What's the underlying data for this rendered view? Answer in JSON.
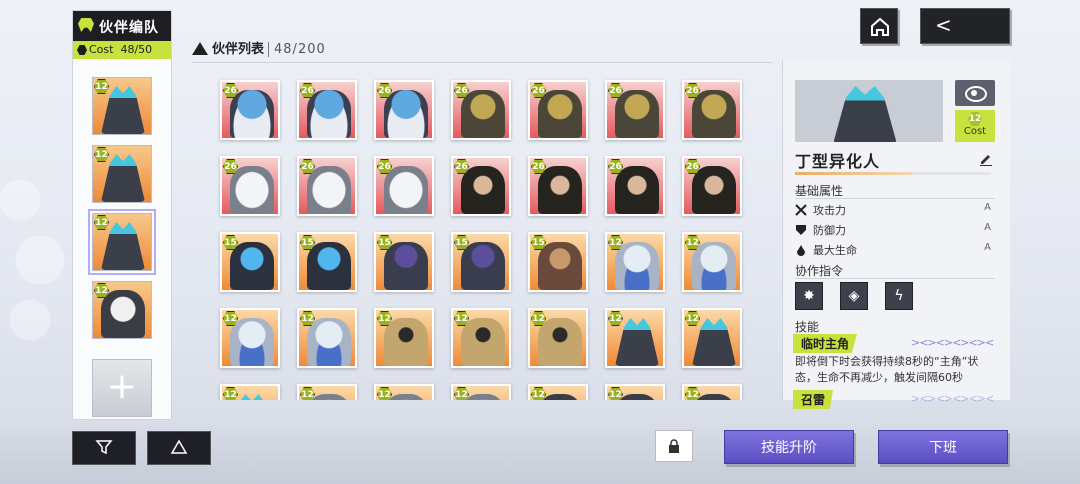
{
  "team": {
    "title": "伙伴编队",
    "cost_label": "Cost",
    "cost_value": "48/50",
    "slots": [
      {
        "level": "12",
        "type": "crys"
      },
      {
        "level": "12",
        "type": "crys"
      },
      {
        "level": "12",
        "type": "crys",
        "selected": true
      },
      {
        "level": "12",
        "type": "robot"
      }
    ],
    "add_symbol": "+"
  },
  "list": {
    "title": "伙伴列表",
    "count": "48/200"
  },
  "grid": [
    {
      "level": "26",
      "bg": "red",
      "type": "blue"
    },
    {
      "level": "26",
      "bg": "red",
      "type": "blue"
    },
    {
      "level": "26",
      "bg": "red",
      "type": "blue"
    },
    {
      "level": "26",
      "bg": "red",
      "type": "gold"
    },
    {
      "level": "26",
      "bg": "red",
      "type": "gold"
    },
    {
      "level": "26",
      "bg": "red",
      "type": "gold"
    },
    {
      "level": "26",
      "bg": "red",
      "type": "gold"
    },
    {
      "level": "26",
      "bg": "red",
      "type": "white"
    },
    {
      "level": "26",
      "bg": "red",
      "type": "white"
    },
    {
      "level": "26",
      "bg": "red",
      "type": "white"
    },
    {
      "level": "26",
      "bg": "red",
      "type": "hair"
    },
    {
      "level": "26",
      "bg": "red",
      "type": "hair"
    },
    {
      "level": "26",
      "bg": "red",
      "type": "hair"
    },
    {
      "level": "26",
      "bg": "red",
      "type": "hair"
    },
    {
      "level": "15",
      "bg": "orange",
      "type": "mech"
    },
    {
      "level": "15",
      "bg": "orange",
      "type": "mech"
    },
    {
      "level": "15",
      "bg": "orange",
      "type": "purple"
    },
    {
      "level": "15",
      "bg": "orange",
      "type": "purple"
    },
    {
      "level": "15",
      "bg": "orange",
      "type": "monk"
    },
    {
      "level": "12",
      "bg": "orange",
      "type": "ghost"
    },
    {
      "level": "12",
      "bg": "orange",
      "type": "ghost"
    },
    {
      "level": "12",
      "bg": "orange",
      "type": "ghost"
    },
    {
      "level": "12",
      "bg": "orange",
      "type": "ghost"
    },
    {
      "level": "12",
      "bg": "orange",
      "type": "tan"
    },
    {
      "level": "12",
      "bg": "orange",
      "type": "tan"
    },
    {
      "level": "12",
      "bg": "orange",
      "type": "tan"
    },
    {
      "level": "12",
      "bg": "orange",
      "type": "crys"
    },
    {
      "level": "12",
      "bg": "orange",
      "type": "crys"
    },
    {
      "level": "12",
      "bg": "orange",
      "type": "crys"
    },
    {
      "level": "12",
      "bg": "orange",
      "type": "white"
    },
    {
      "level": "12",
      "bg": "orange",
      "type": "white"
    },
    {
      "level": "12",
      "bg": "orange",
      "type": "white"
    },
    {
      "level": "12",
      "bg": "orange",
      "type": "robot"
    },
    {
      "level": "12",
      "bg": "orange",
      "type": "robot"
    },
    {
      "level": "12",
      "bg": "orange",
      "type": "robot"
    }
  ],
  "detail": {
    "cost_num": "12",
    "cost_label": "Cost",
    "name": "丁型异化人",
    "base_attr_title": "基础属性",
    "attrs": [
      {
        "label": "攻击力",
        "grade": "A",
        "icon": "sword-icon"
      },
      {
        "label": "防御力",
        "grade": "A",
        "icon": "shield-icon"
      },
      {
        "label": "最大生命",
        "grade": "A",
        "icon": "drop-icon"
      }
    ],
    "command_title": "协作指令",
    "commands": [
      "burst-icon",
      "diamond-icon",
      "bolt-icon"
    ],
    "skill_title": "技能",
    "skills": [
      {
        "name": "临时主角",
        "desc": "即将倒下时会获得持续8秒的“主角”状态，生命不再减少，触发间隔60秒"
      },
      {
        "name": "召雷",
        "desc": ""
      }
    ],
    "skill_deco": "><><><><><"
  },
  "nav": {
    "back_symbol": "<"
  },
  "actions": {
    "upgrade": "技能升阶",
    "dismiss": "下班"
  },
  "colors": {
    "accent": "#c8e13c",
    "primary": "#6a5ed1",
    "dark": "#1e1e22"
  }
}
